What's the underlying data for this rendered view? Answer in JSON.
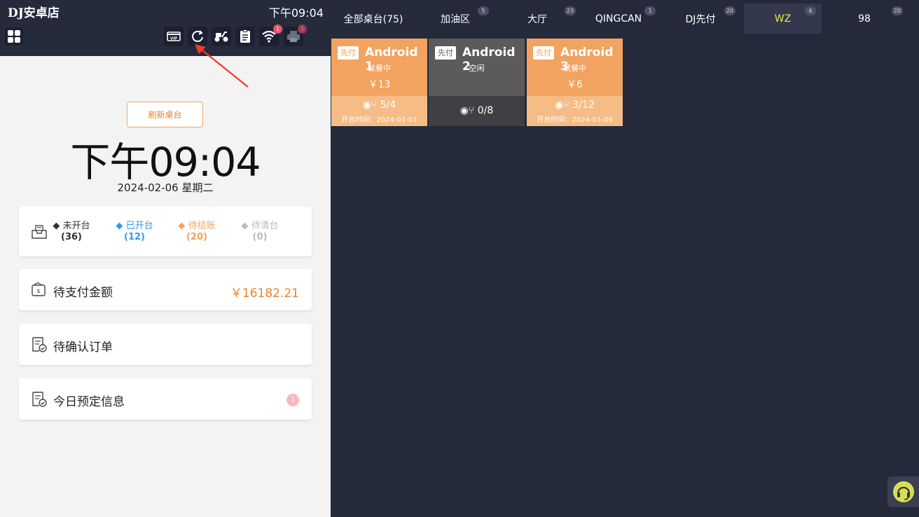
{
  "header": {
    "store_name": "DJ安卓店",
    "time": "下午09:04",
    "icons": [
      "grid-icon",
      "vip-card-icon",
      "refresh-icon",
      "scooter-icon",
      "clipboard-icon",
      "wifi-icon",
      "printer-icon"
    ],
    "wifi_badge": "1",
    "printer_badge": "5"
  },
  "left": {
    "refresh_label": "刷新桌台",
    "big_time": "下午09:04",
    "date": "2024-02-06 星期二",
    "status": [
      {
        "label": "未开台",
        "count": "(36)",
        "color": "#333333"
      },
      {
        "label": "已开台",
        "count": "(12)",
        "color": "#2e9cf0"
      },
      {
        "label": "待结账",
        "count": "(20)",
        "color": "#f2a35f"
      },
      {
        "label": "待清台",
        "count": "(0)",
        "color": "#bbbbbb"
      }
    ],
    "pending_payment_label": "待支付金额",
    "pending_payment_amount": "￥16182.21",
    "pending_confirm_label": "待确认订单",
    "reservation_label": "今日预定信息",
    "reservation_badge": "1"
  },
  "tabs": [
    {
      "label": "全部桌台(75)",
      "badge": ""
    },
    {
      "label": "加油区",
      "badge": "5"
    },
    {
      "label": "大厅",
      "badge": "23"
    },
    {
      "label": "QINGCAN",
      "badge": "1"
    },
    {
      "label": "DJ先付",
      "badge": "20"
    },
    {
      "label": "WZ",
      "badge": "6",
      "active": true
    },
    {
      "label": "98",
      "badge": "20"
    }
  ],
  "tables": [
    {
      "tag": "先付",
      "name": "Android 1",
      "status": "就餐中",
      "price": "￥13",
      "seats": "5/4",
      "open_time": "开台时间：2024-01-01",
      "color": "#f2a35f"
    },
    {
      "tag": "先付",
      "name": "Android 2",
      "status": "空闲",
      "price": "",
      "seats": "0/8",
      "open_time": "",
      "color": "#5b5b5d"
    },
    {
      "tag": "先付",
      "name": "Android 3",
      "status": "就餐中",
      "price": "￥6",
      "seats": "3/12",
      "open_time": "开台时间：2024-01-09",
      "color": "#f2a35f"
    }
  ],
  "colors": {
    "accent": "#e9832c",
    "active_tab": "#e4ea5a",
    "bg_dark": "#252a3b"
  }
}
